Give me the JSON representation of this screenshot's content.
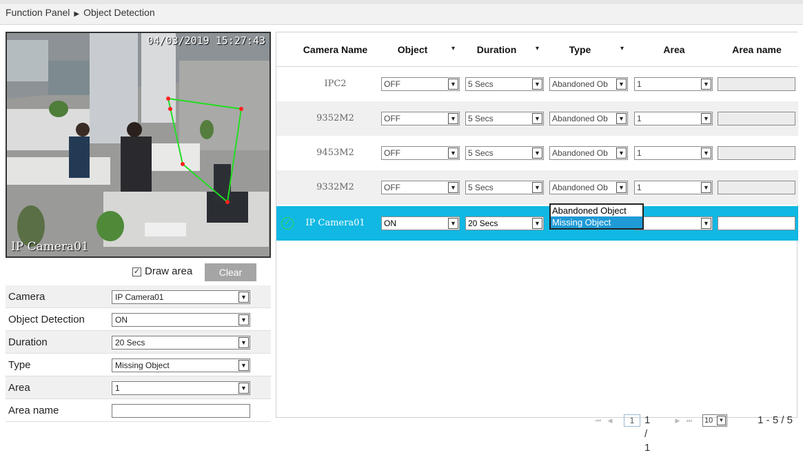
{
  "breadcrumb": {
    "root": "Function Panel",
    "separator": "▶",
    "current": "Object Detection"
  },
  "video": {
    "timestamp": "04/03/2019 15:27:43",
    "camera_label": "IP Camera01"
  },
  "draw": {
    "checkbox_mark": "✓",
    "label": "Draw area",
    "clear_label": "Clear"
  },
  "form": {
    "camera": {
      "label": "Camera",
      "value": "IP Camera01"
    },
    "object_detection": {
      "label": "Object Detection",
      "value": "ON"
    },
    "duration": {
      "label": "Duration",
      "value": "20 Secs"
    },
    "type": {
      "label": "Type",
      "value": "Missing Object"
    },
    "area": {
      "label": "Area",
      "value": "1"
    },
    "area_name": {
      "label": "Area name",
      "value": ""
    }
  },
  "table": {
    "headers": {
      "camera_name": "Camera Name",
      "object": "Object",
      "duration": "Duration",
      "type": "Type",
      "area": "Area",
      "area_name": "Area name"
    },
    "sort_glyph": "▾",
    "rows": [
      {
        "camera": "IPC2",
        "object": "OFF",
        "duration": "5 Secs",
        "type": "Abandoned Ob",
        "area": "1",
        "area_name": ""
      },
      {
        "camera": "9352M2",
        "object": "OFF",
        "duration": "5 Secs",
        "type": "Abandoned Ob",
        "area": "1",
        "area_name": ""
      },
      {
        "camera": "9453M2",
        "object": "OFF",
        "duration": "5 Secs",
        "type": "Abandoned Ob",
        "area": "1",
        "area_name": ""
      },
      {
        "camera": "9332M2",
        "object": "OFF",
        "duration": "5 Secs",
        "type": "Abandoned Ob",
        "area": "1",
        "area_name": ""
      },
      {
        "camera": "IP Camera01",
        "object": "ON",
        "duration": "20 Secs",
        "type": "",
        "area": "",
        "area_name": ""
      }
    ],
    "type_options": [
      "Abandoned Object",
      "Missing Object"
    ],
    "type_selected": "Missing Object"
  },
  "pager": {
    "current_page": "1",
    "page_display": "1 / 1",
    "page_size": "10",
    "range": "1 - 5 / 5"
  },
  "icons": {
    "select_arrow": "▼",
    "first": "⏮",
    "prev": "◀",
    "next": "▶",
    "last": "⏭",
    "selected_check": "✓"
  },
  "colors": {
    "selected_row": "#11b8e3",
    "highlight_option": "#1f9ad6",
    "detect_line": "#22dd22",
    "detect_vertex": "#ff2020"
  }
}
